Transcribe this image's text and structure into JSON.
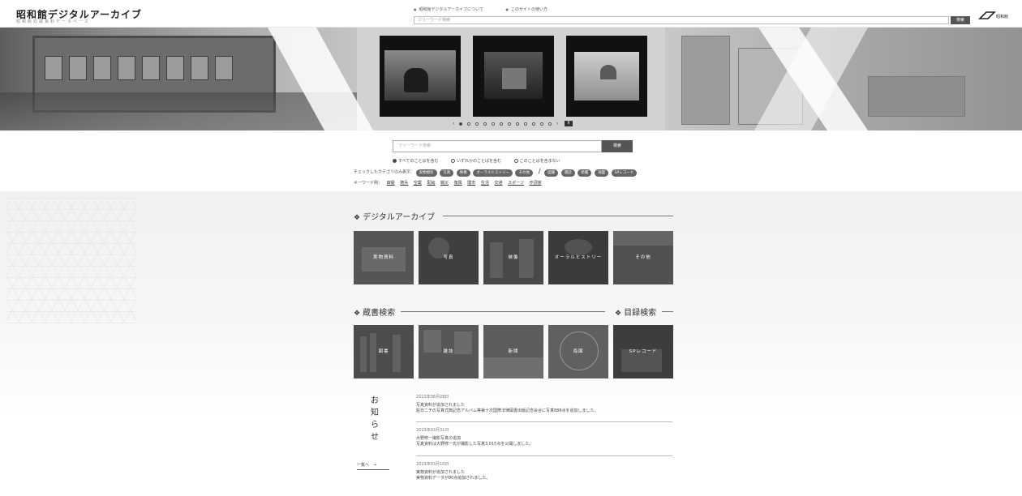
{
  "header": {
    "site_title": "昭和館デジタルアーカイブ",
    "site_subtitle": "昭和館収蔵資料データベース",
    "links": [
      "昭和館デジタルアーカイブについて",
      "このサイトの使い方"
    ],
    "search_placeholder": "フリーワード検索",
    "search_button": "検索",
    "logo_text": "昭和館"
  },
  "hero": {
    "slide_count": 12,
    "active_slide": 0,
    "pause_label": "II",
    "prev_arrow": "‹",
    "next_arrow": "›"
  },
  "search": {
    "placeholder": "フリーワード検索",
    "button": "検索",
    "radio_options": [
      "すべてのことばを含む",
      "いずれかのことばを含む",
      "このことばを含まない"
    ],
    "radio_selected": 0,
    "category_label": "チェックしたカテゴリのみ表示：",
    "categories_archive": [
      "実物資料",
      "写真",
      "映像",
      "オーラルヒストリー",
      "その他"
    ],
    "categories_library": [
      "図書",
      "雑誌",
      "新聞",
      "海図",
      "SPレコード"
    ],
    "keyword_label": "キーワード例：",
    "keywords": [
      "疎開",
      "徴兵",
      "空襲",
      "配給",
      "戦災",
      "復興",
      "闇市",
      "生活",
      "交通",
      "スポーツ",
      "作詞家"
    ]
  },
  "archive": {
    "heading": "デジタルアーカイブ",
    "tiles": [
      "実物資料",
      "写真",
      "映像",
      "オーラルヒストリー",
      "その他"
    ]
  },
  "library": {
    "heading": "蔵書検索",
    "catalog_heading": "目録検索",
    "tiles": [
      "図書",
      "雑誌",
      "新聞",
      "海図",
      "SPレコード"
    ]
  },
  "news": {
    "title": "お知らせ",
    "more": "一覧へ　→",
    "items": [
      {
        "date": "2023年06月28日",
        "title": "写真資料が追加されました",
        "body": "駐日ニチの写真式典記念アルバム等第十次国際法律図書出版記念会合に写真888点を追加しました。"
      },
      {
        "date": "2023年03月31日",
        "title": "大野修一撮影写真の追加",
        "body": "写真資料は大野修一氏が撮影した写真3,015点を公開しました。"
      },
      {
        "date": "2023年03月10日",
        "title": "実物資料が追加されました",
        "body": "実物資料データが80点追加されました。"
      }
    ]
  },
  "colors": {
    "chip": "#666666",
    "button": "#555555",
    "tile": "#4a4a4a"
  }
}
